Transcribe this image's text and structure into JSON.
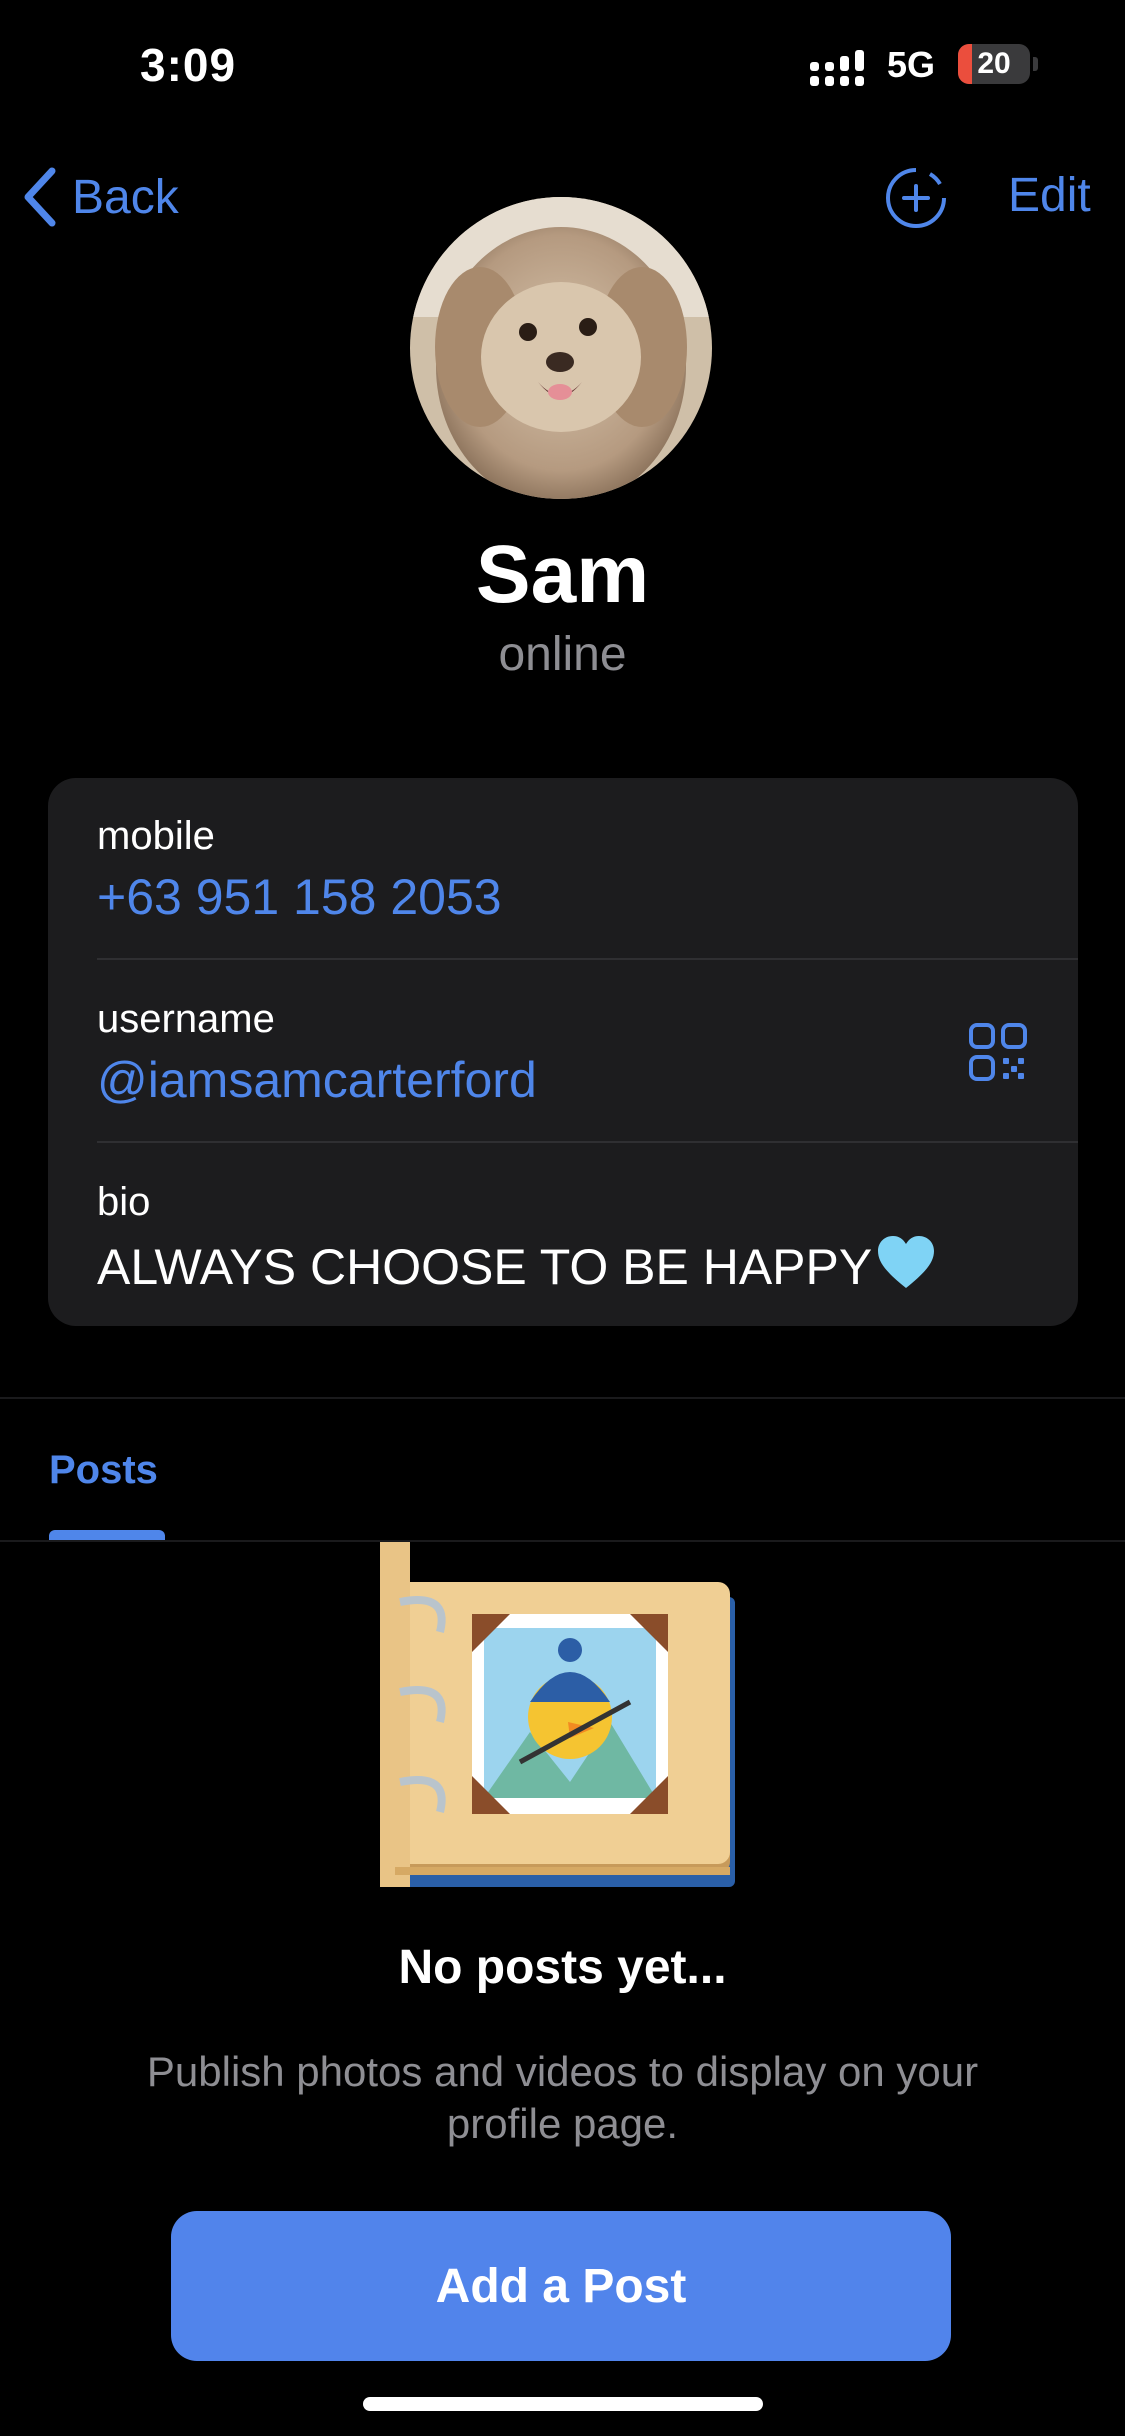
{
  "status_bar": {
    "time": "3:09",
    "network": "5G",
    "battery_level": "20",
    "battery_fraction": 0.2
  },
  "nav": {
    "back_label": "Back",
    "edit_label": "Edit"
  },
  "profile": {
    "name": "Sam",
    "status": "online"
  },
  "info": {
    "mobile_label": "mobile",
    "mobile_value": "+63 951 158 2053",
    "username_label": "username",
    "username_value": "@iamsamcarterford",
    "bio_label": "bio",
    "bio_value": "ALWAYS CHOOSE TO BE HAPPY"
  },
  "tabs": {
    "posts_label": "Posts"
  },
  "empty_state": {
    "title": "No posts yet...",
    "description": "Publish photos and videos to display on your profile page."
  },
  "add_post_label": "Add a Post",
  "colors": {
    "accent": "#4f86ea",
    "background": "#000000",
    "card": "#1c1c1e",
    "secondary_text": "#8e8e93",
    "battery_low": "#eb4e3d"
  }
}
